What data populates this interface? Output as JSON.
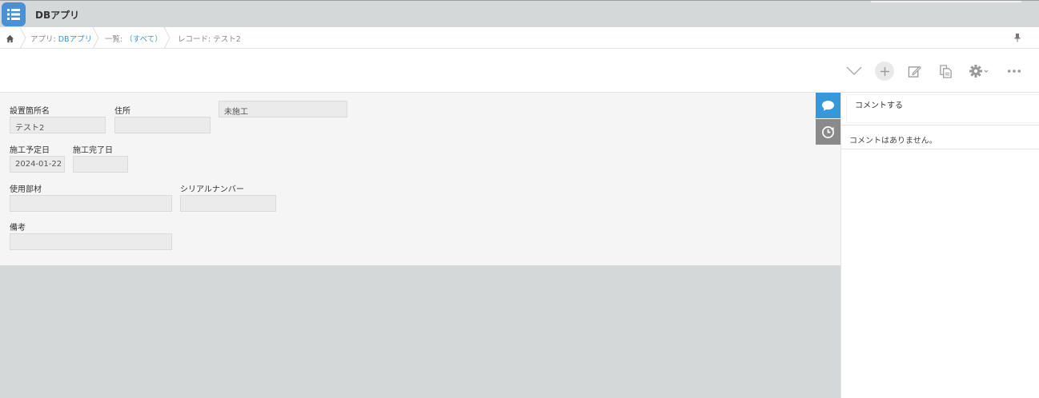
{
  "header": {
    "app_title": "DBアプリ"
  },
  "breadcrumb": {
    "app_prefix": "アプリ: ",
    "app_name": "DBアプリ",
    "list_prefix": "一覧: ",
    "list_name": "（すべて）",
    "record": "レコード: テスト2"
  },
  "toolbar": {
    "icons": [
      "chevron-down-icon",
      "plus-icon",
      "edit-icon",
      "copy-icon",
      "gear-icon",
      "more-icon"
    ]
  },
  "form": {
    "location_label": "設置箇所名",
    "location_value": "テスト2",
    "address_label": "住所",
    "address_value": "",
    "status_value": "未施工",
    "planned_date_label": "施工予定日",
    "planned_date_value": "2024-01-22",
    "completed_date_label": "施工完了日",
    "completed_date_value": "",
    "material_label": "使用部材",
    "material_value": "",
    "serial_label": "シリアルナンバー",
    "serial_value": "",
    "notes_label": "備考",
    "notes_value": ""
  },
  "comments": {
    "input_placeholder": "コメントする",
    "empty_message": "コメントはありません。"
  },
  "colors": {
    "accent": "#3498db",
    "app_icon": "#4a90d6",
    "history_tab": "#8a8a8a"
  }
}
